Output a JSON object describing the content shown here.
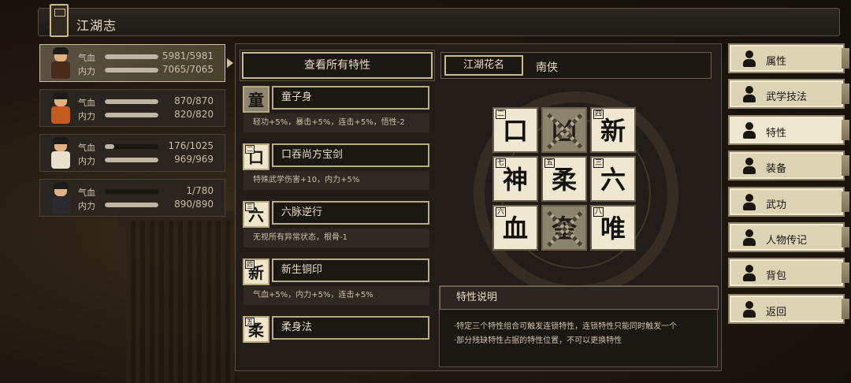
{
  "title": "江湖志",
  "characters": [
    {
      "hp_label": "气血",
      "mp_label": "内力",
      "hp": "5981/5981",
      "mp": "7065/7065",
      "hp_frac": 1.0,
      "mp_frac": 1.0,
      "active": true,
      "robe": "#4a2a1a"
    },
    {
      "hp_label": "气血",
      "mp_label": "内力",
      "hp": "870/870",
      "mp": "820/820",
      "hp_frac": 1.0,
      "mp_frac": 1.0,
      "active": false,
      "robe": "#c45a1e"
    },
    {
      "hp_label": "气血",
      "mp_label": "内力",
      "hp": "176/1025",
      "mp": "969/969",
      "hp_frac": 0.17,
      "mp_frac": 1.0,
      "active": false,
      "robe": "#e8e0cc"
    },
    {
      "hp_label": "气血",
      "mp_label": "内力",
      "hp": "1/780",
      "mp": "890/890",
      "hp_frac": 0.0,
      "mp_frac": 1.0,
      "active": false,
      "robe": "#2a2a2e"
    }
  ],
  "view_all": "查看所有特性",
  "traits": [
    {
      "icon": "童",
      "num": "",
      "locked": true,
      "name": "童子身",
      "desc": "轻功+5%，暴击+5%，连击+5%，悟性-2"
    },
    {
      "icon": "口",
      "num": "二",
      "locked": false,
      "name": "口吞尚方宝剑",
      "desc": "特殊武学伤害+10，内力+5%"
    },
    {
      "icon": "六",
      "num": "三",
      "locked": false,
      "name": "六脉逆行",
      "desc": "无视所有异常状态，根骨-1"
    },
    {
      "icon": "新",
      "num": "四",
      "locked": false,
      "name": "新生铜印",
      "desc": "气血+5%，内力+5%，连击+5%"
    },
    {
      "icon": "柔",
      "num": "五",
      "locked": false,
      "name": "柔身法",
      "desc": ""
    }
  ],
  "nickname": {
    "label": "江湖花名",
    "value": "南侠"
  },
  "grid": [
    {
      "char": "口",
      "num": "二",
      "locked": false
    },
    {
      "char": "凶",
      "num": "",
      "locked": true
    },
    {
      "char": "新",
      "num": "四",
      "locked": false
    },
    {
      "char": "神",
      "num": "七",
      "locked": false
    },
    {
      "char": "柔",
      "num": "五",
      "locked": false
    },
    {
      "char": "六",
      "num": "三",
      "locked": false
    },
    {
      "char": "血",
      "num": "六",
      "locked": false
    },
    {
      "char": "奎",
      "num": "",
      "locked": true
    },
    {
      "char": "唯",
      "num": "八",
      "locked": false
    }
  ],
  "explain": {
    "title": "特性说明",
    "lines": [
      "·特定三个特性组合可触发连锁特性，连锁特性只能同时触发一个",
      "·部分残缺特性占据的特性位置，不可以更换特性"
    ]
  },
  "menu": [
    {
      "label": "属性",
      "icon": "person-icon",
      "active": false
    },
    {
      "label": "武学技法",
      "icon": "skills-icon",
      "active": false
    },
    {
      "label": "特性",
      "icon": "trait-icon",
      "active": true
    },
    {
      "label": "装备",
      "icon": "sword-icon",
      "active": false
    },
    {
      "label": "武功",
      "icon": "book-icon",
      "active": false
    },
    {
      "label": "人物传记",
      "icon": "scroll-icon",
      "active": false
    },
    {
      "label": "背包",
      "icon": "bag-icon",
      "active": false
    },
    {
      "label": "返回",
      "icon": "door-icon",
      "active": false
    }
  ]
}
